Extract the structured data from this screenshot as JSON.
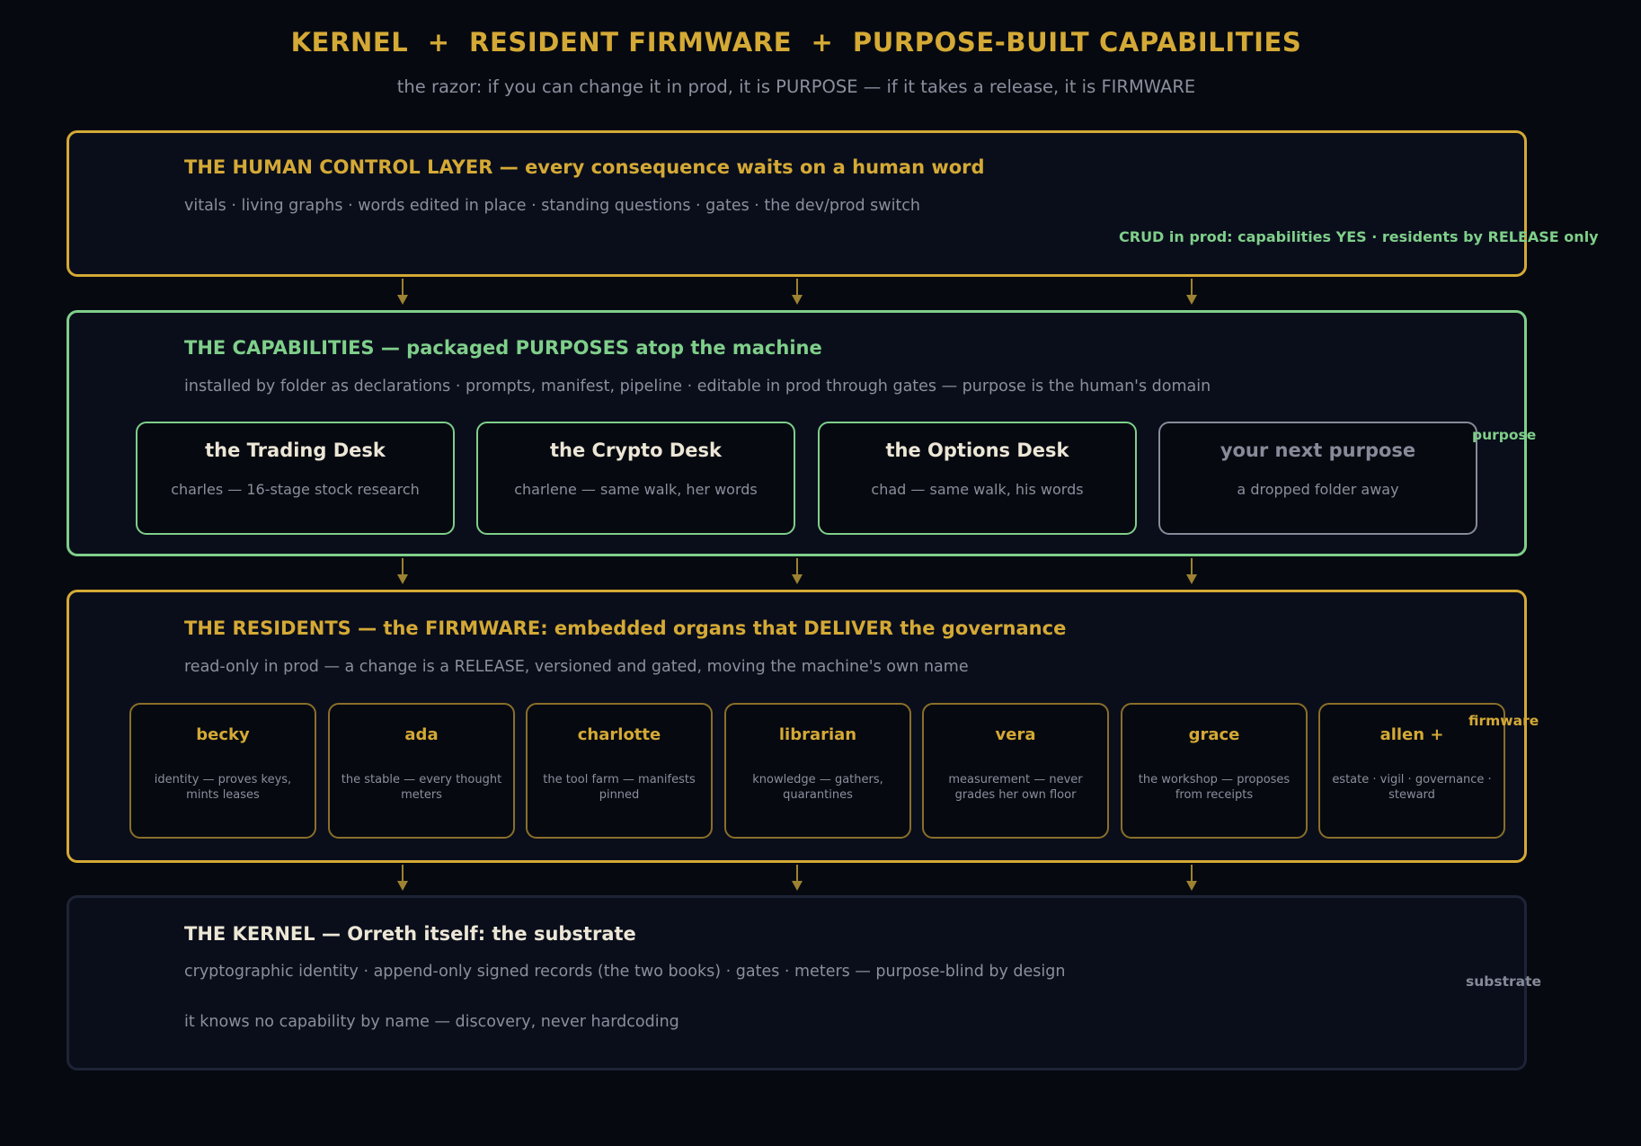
{
  "header": {
    "title": "KERNEL  +  RESIDENT FIRMWARE  +  PURPOSE-BUILT CAPABILITIES",
    "subtitle": "the razor: if you can change it in prod, it is PURPOSE — if it takes a release, it is FIRMWARE"
  },
  "human_layer": {
    "title": "THE HUMAN CONTROL LAYER — every consequence waits on a human word",
    "desc": "vitals · living graphs · words edited in place · standing questions · gates · the dev/prod switch",
    "crud_note": "CRUD in prod: capabilities YES · residents by RELEASE only"
  },
  "capabilities": {
    "title": "THE CAPABILITIES — packaged PURPOSES atop the machine",
    "desc": "installed by folder as declarations · prompts, manifest, pipeline · editable in prod through gates — purpose is the human's domain",
    "side_label": "purpose",
    "cards": [
      {
        "name": "the Trading Desk",
        "desc": "charles — 16-stage stock research"
      },
      {
        "name": "the Crypto Desk",
        "desc": "charlene — same walk, her words"
      },
      {
        "name": "the Options Desk",
        "desc": "chad — same walk, his words"
      },
      {
        "name": "your next purpose",
        "desc": "a dropped folder away"
      }
    ]
  },
  "residents": {
    "title": "THE RESIDENTS — the FIRMWARE: embedded organs that DELIVER the governance",
    "desc": "read-only in prod — a change is a RELEASE, versioned and gated, moving the machine's own name",
    "side_label": "firmware",
    "cards": [
      {
        "name": "becky",
        "desc": "identity — proves keys, mints leases"
      },
      {
        "name": "ada",
        "desc": "the stable — every thought meters"
      },
      {
        "name": "charlotte",
        "desc": "the tool farm — manifests pinned"
      },
      {
        "name": "librarian",
        "desc": "knowledge — gathers, quarantines"
      },
      {
        "name": "vera",
        "desc": "measurement — never grades her own floor"
      },
      {
        "name": "grace",
        "desc": "the workshop — proposes from receipts"
      },
      {
        "name": "allen +",
        "desc": "estate · vigil · governance · steward"
      }
    ]
  },
  "kernel": {
    "title": "THE KERNEL — Orreth itself: the substrate",
    "desc": "cryptographic identity · append-only signed records (the two books) · gates · meters — purpose-blind by design",
    "note": "it knows no capability by name — discovery, never hardcoding",
    "side_label": "substrate"
  },
  "colors": {
    "gold": "#d4a935",
    "green": "#7fcf8a",
    "gray": "#8a8f9c",
    "arrow": "#9c8231",
    "background": "#060910",
    "panel": "#0a0e1b"
  }
}
